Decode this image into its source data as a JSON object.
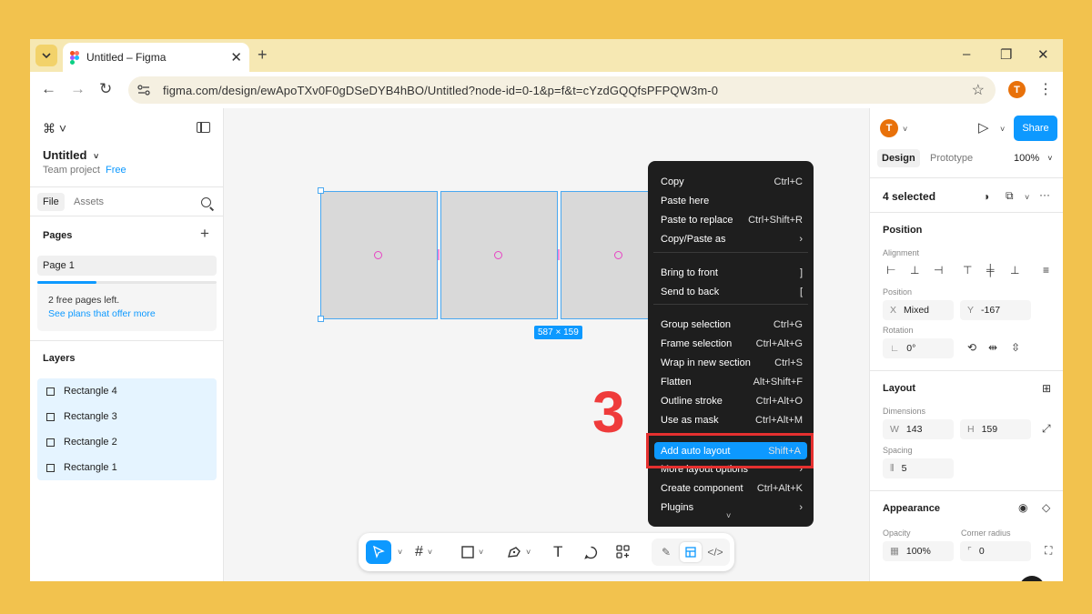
{
  "browser": {
    "tab_title": "Untitled – Figma",
    "new_tab": "+",
    "url": "figma.com/design/ewApoTXv0F0gDSeDYB4hBO/Untitled?node-id=0-1&p=f&t=cYzdGQQfsPFPQW3m-0",
    "profile_initial": "T",
    "window_controls": [
      "–",
      "❐",
      "✕"
    ]
  },
  "left_panel": {
    "file_name": "Untitled",
    "team": "Team project",
    "plan": "Free",
    "tabs": [
      "File",
      "Assets"
    ],
    "pages_title": "Pages",
    "pages": [
      "Page 1"
    ],
    "free_pages_progress": 0.33,
    "free_pages_text": "2 free pages left.",
    "free_pages_link": "See plans that offer more",
    "layers_title": "Layers",
    "layers": [
      "Rectangle 4",
      "Rectangle 3",
      "Rectangle 2",
      "Rectangle 1"
    ]
  },
  "canvas": {
    "dimension_badge": "587 × 159",
    "step_number": "3"
  },
  "context_menu": {
    "items": [
      {
        "label": "Copy",
        "shortcut": "Ctrl+C"
      },
      {
        "label": "Paste here",
        "shortcut": ""
      },
      {
        "label": "Paste to replace",
        "shortcut": "Ctrl+Shift+R"
      },
      {
        "label": "Copy/Paste as",
        "shortcut": "›"
      },
      {
        "label": "Bring to front",
        "shortcut": "]"
      },
      {
        "label": "Send to back",
        "shortcut": "["
      },
      {
        "label": "Group selection",
        "shortcut": "Ctrl+G"
      },
      {
        "label": "Frame selection",
        "shortcut": "Ctrl+Alt+G"
      },
      {
        "label": "Wrap in new section",
        "shortcut": "Ctrl+S"
      },
      {
        "label": "Flatten",
        "shortcut": "Alt+Shift+F"
      },
      {
        "label": "Outline stroke",
        "shortcut": "Ctrl+Alt+O"
      },
      {
        "label": "Use as mask",
        "shortcut": "Ctrl+Alt+M"
      },
      {
        "label": "Add auto layout",
        "shortcut": "Shift+A"
      },
      {
        "label": "More layout options",
        "shortcut": "›"
      },
      {
        "label": "Create component",
        "shortcut": "Ctrl+Alt+K"
      },
      {
        "label": "Plugins",
        "shortcut": "›"
      }
    ],
    "highlighted": "Add auto layout"
  },
  "right_panel": {
    "avatar_initial": "T",
    "share_label": "Share",
    "tabs": [
      "Design",
      "Prototype"
    ],
    "zoom": "100%",
    "selection": "4 selected",
    "position_title": "Position",
    "alignment_label": "Alignment",
    "position_label": "Position",
    "x_label": "X",
    "x_value": "Mixed",
    "y_label": "Y",
    "y_value": "-167",
    "rotation_label": "Rotation",
    "rotation_value": "0°",
    "layout_title": "Layout",
    "dimensions_label": "Dimensions",
    "w_label": "W",
    "w_value": "143",
    "h_label": "H",
    "h_value": "159",
    "spacing_label": "Spacing",
    "spacing_value": "5",
    "appearance_title": "Appearance",
    "opacity_label": "Opacity",
    "opacity_value": "100%",
    "corner_label": "Corner radius",
    "corner_value": "0",
    "help": "?"
  },
  "colors": {
    "background": "#f2c24e",
    "accent": "#0d99ff",
    "highlight_box": "#e5302f",
    "step_number": "#ef3b3b"
  }
}
